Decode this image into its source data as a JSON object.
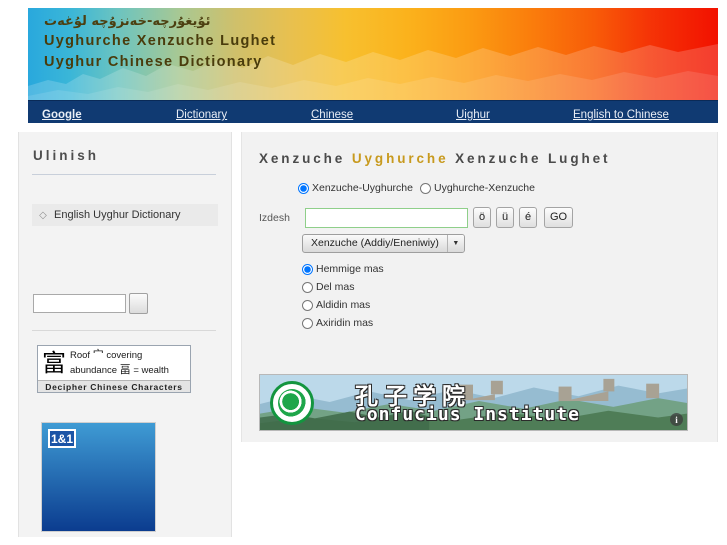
{
  "header": {
    "title_arabic": "ئۇيغۇرچە-خەنزۇچە لۇغەت",
    "title_latin": "Uyghurche Xenzuche Lughet",
    "title_english": "Uyghur Chinese Dictionary"
  },
  "nav": {
    "items": [
      {
        "label": "Google"
      },
      {
        "label": "Dictionary"
      },
      {
        "label": "Chinese"
      },
      {
        "label": "Uighur"
      },
      {
        "label": "English to Chinese"
      }
    ]
  },
  "sidebar": {
    "title": "Ulinish",
    "link": {
      "label": "English Uyghur Dictionary",
      "icon": "diamond-bullet-icon"
    },
    "search": {
      "value": "",
      "placeholder": "",
      "button_label": ""
    },
    "ad_chinese": {
      "big_char": "富",
      "line1_a": "Roof",
      "line1_glyph": "宀",
      "line1_b": "covering",
      "line2_a": "abundance",
      "line2_glyph": "畐",
      "line2_b": "= wealth",
      "footer": "Decipher Chinese Characters"
    },
    "ad_banner": {
      "logo": "1&1"
    }
  },
  "main": {
    "title_part1": "Xenzuche",
    "title_highlight": "Uyghurche",
    "title_part2": "Xenzuche",
    "title_part3": "Lughet",
    "direction": {
      "options": [
        {
          "label": "Xenzuche-Uyghurche",
          "selected": true
        },
        {
          "label": "Uyghurche-Xenzuche",
          "selected": false
        }
      ]
    },
    "search": {
      "label": "Izdesh",
      "value": "",
      "placeholder": "",
      "char_buttons": [
        "ö",
        "ü",
        "é"
      ],
      "go_label": "GO"
    },
    "script_select": {
      "value": "Xenzuche (Addiy/Eneniwiy)",
      "arrow_icon": "chevron-down-icon"
    },
    "match_options": [
      {
        "label": "Hemmige mas",
        "selected": true
      },
      {
        "label": "Del mas",
        "selected": false
      },
      {
        "label": "Aldidin mas",
        "selected": false
      },
      {
        "label": "Axiridin mas",
        "selected": false
      }
    ],
    "ad_confucius": {
      "chinese": "孔子学院",
      "english": "Confucius Institute",
      "info_icon": "info-icon",
      "logo": "confucius-institute-logo"
    }
  },
  "colors": {
    "navbar": "#103a72",
    "title_highlight": "#c89a1e",
    "input_border": "#8fcf8a",
    "panel_bg": "#f2f2f2"
  }
}
